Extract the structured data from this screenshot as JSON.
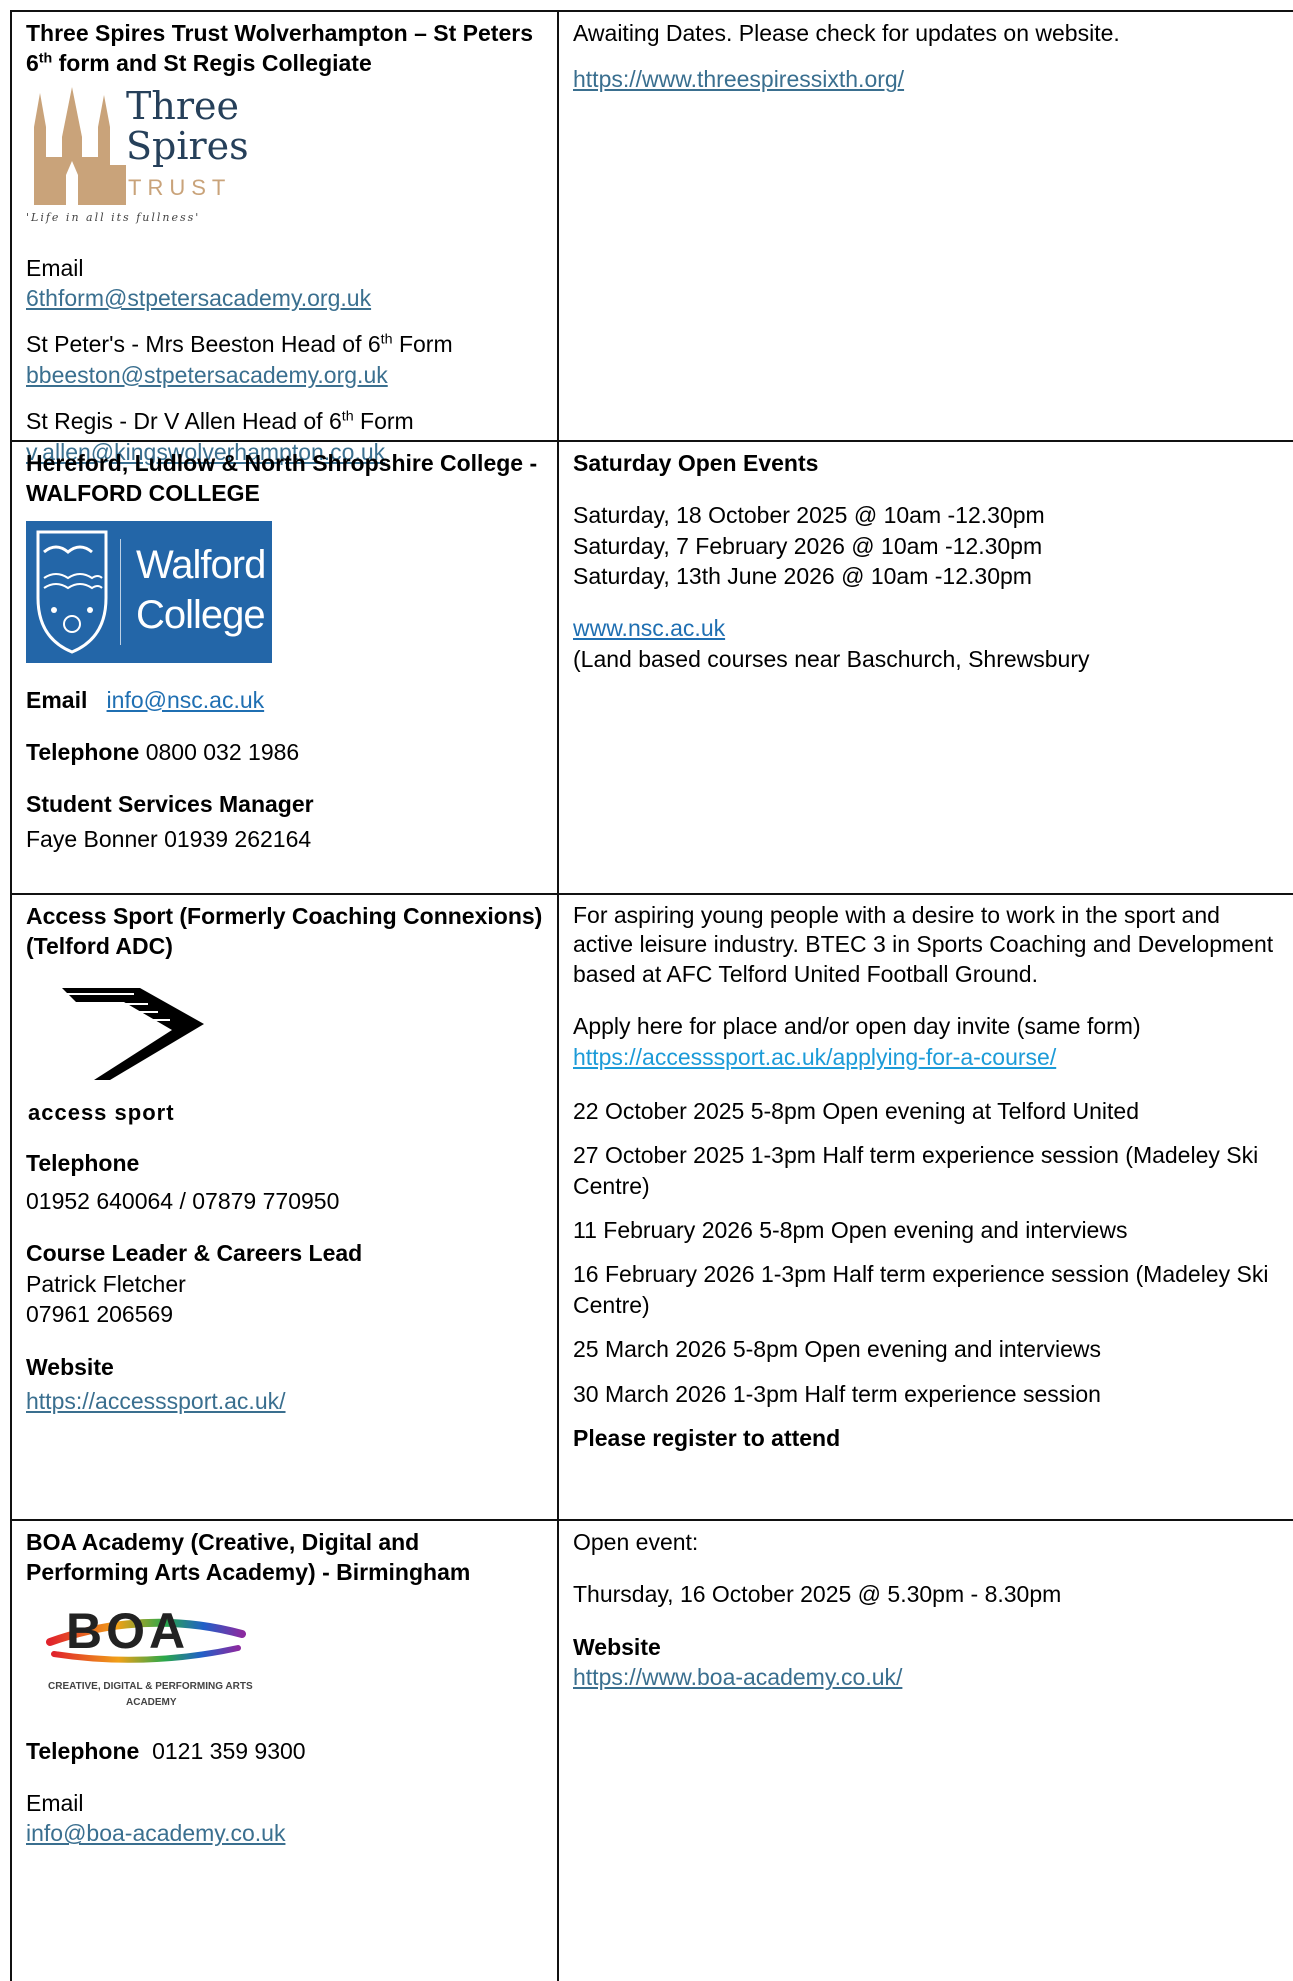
{
  "rows": [
    {
      "title_pre": "Three Spires Trust Wolverhampton – St Peters 6",
      "title_sup": "th",
      "title_post": " form and St Regis Collegiate",
      "logo": {
        "line1": "Three",
        "line2": "Spires",
        "line3": "TRUST",
        "tagline": "'Life in all its fullness'",
        "color": "#c9a37a"
      },
      "email_label": "Email",
      "email": "6thform@stpetersacademy.org.uk",
      "contact1_pre": "St Peter's - Mrs Beeston Head of 6",
      "contact1_sup": "th",
      "contact1_post": " Form",
      "contact1_email": "bbeeston@stpetersacademy.org.uk",
      "contact2_pre": "St Regis - Dr V Allen Head of 6",
      "contact2_sup": "th",
      "contact2_post": " Form",
      "contact2_email": "v.allen@kingswolverhampton.co.uk",
      "right_text": "Awaiting Dates.  Please check for updates on website.",
      "right_link": "https://www.threespiressixth.org/"
    },
    {
      "title": "Hereford, Ludlow & North Shropshire College - WALFORD COLLEGE",
      "logo": {
        "line1": "Walford",
        "line2": "College",
        "color": "#2366a8"
      },
      "email_label": "Email",
      "email": "info@nsc.ac.uk",
      "phone_label": "Telephone",
      "phone": "0800 032 1986",
      "manager_label": "Student Services Manager",
      "manager": "Faye Bonner  01939 262164",
      "right_heading": "Saturday Open Events",
      "dates": [
        "Saturday, 18 October 2025 @ 10am -12.30pm",
        "Saturday, 7 February 2026 @ 10am -12.30pm",
        "Saturday, 13th June 2026 @ 10am -12.30pm"
      ],
      "right_link": "www.nsc.ac.uk",
      "right_note": "(Land based courses near Baschurch, Shrewsbury"
    },
    {
      "title": "Access Sport (Formerly Coaching Connexions) (Telford ADC)",
      "logo": {
        "text": "access sport"
      },
      "phone_label": "Telephone",
      "phone": "01952 640064 / 07879 770950",
      "lead_label": "Course Leader & Careers Lead",
      "lead_name": "Patrick Fletcher",
      "lead_phone": "07961 206569",
      "web_label": "Website",
      "web": "https://accesssport.ac.uk/",
      "intro": "For aspiring young people with a desire to work in the sport and active leisure industry. BTEC 3 in Sports Coaching and Development based at AFC Telford United Football Ground.",
      "apply_text": "Apply here for place and/or open day invite (same form)",
      "apply_link": "https://accesssport.ac.uk/applying-for-a-course/",
      "events": [
        "22 October 2025 5-8pm Open evening at Telford United",
        "27 October 2025 1-3pm Half term experience session (Madeley Ski Centre)",
        "11 February 2026 5-8pm Open evening and interviews",
        "16 February 2026 1-3pm Half term experience session (Madeley Ski Centre)",
        "25 March 2026 5-8pm Open evening and interviews",
        "30 March 2026 1-3pm Half term experience session"
      ],
      "register": "Please register to attend"
    },
    {
      "title": "BOA Academy (Creative, Digital and Performing Arts Academy) - Birmingham",
      "logo": {
        "text": "BOA",
        "sub1": "CREATIVE, DIGITAL & PERFORMING ARTS",
        "sub2": "ACADEMY"
      },
      "phone_label": "Telephone",
      "phone": "0121 359 9300",
      "email_label": "Email",
      "email": "info@boa-academy.co.uk",
      "right_heading": "Open event:",
      "date": "Thursday, 16 October 2025 @ 5.30pm - 8.30pm",
      "web_label": "Website",
      "web": "https://www.boa-academy.co.uk/"
    }
  ]
}
